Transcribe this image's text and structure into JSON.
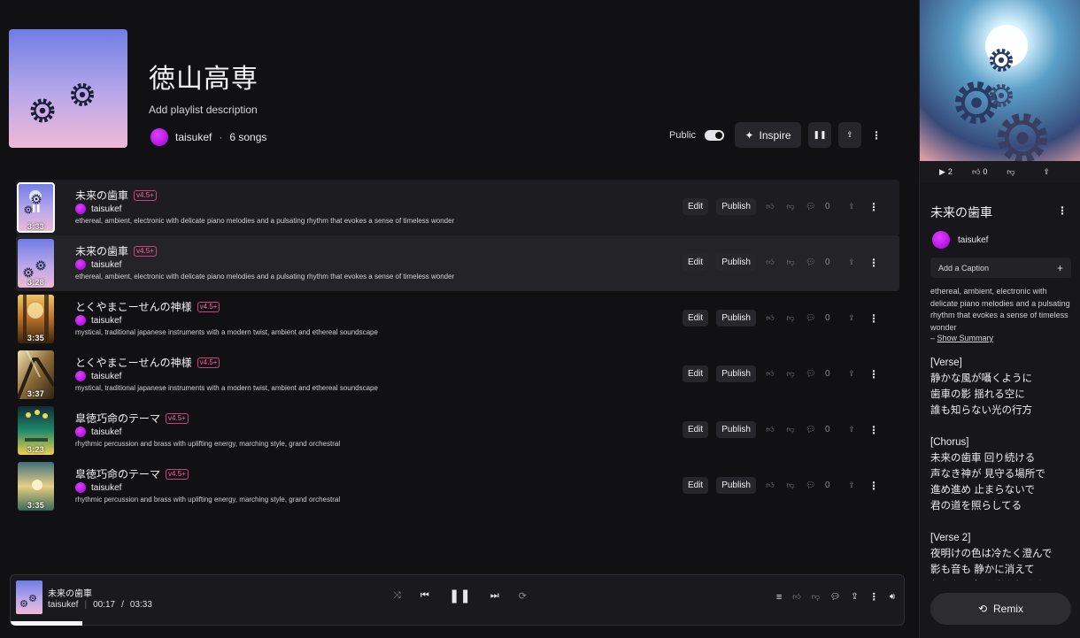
{
  "playlist": {
    "title": "徳山高専",
    "description_placeholder": "Add playlist description",
    "owner": "taisukef",
    "separator": "·",
    "song_count": "6 songs",
    "public_label": "Public",
    "public_on": true,
    "inspire_label": "Inspire"
  },
  "songs": [
    {
      "title": "未来の歯車",
      "version": "v4.5+",
      "artist": "taisukef",
      "description": "ethereal, ambient, electronic with delicate piano melodies and a pulsating rhythm that evokes a sense of timeless wonder",
      "duration": "3:33",
      "edit": "Edit",
      "publish": "Publish",
      "comments": "0"
    },
    {
      "title": "未来の歯車",
      "version": "v4.5+",
      "artist": "taisukef",
      "description": "ethereal, ambient, electronic with delicate piano melodies and a pulsating rhythm that evokes a sense of timeless wonder",
      "duration": "3:28",
      "edit": "Edit",
      "publish": "Publish",
      "comments": "0"
    },
    {
      "title": "とくやまこーせんの神様",
      "version": "v4.5+",
      "artist": "taisukef",
      "description": "mystical, traditional japanese instruments with a modern twist, ambient and ethereal soundscape",
      "duration": "3:35",
      "edit": "Edit",
      "publish": "Publish",
      "comments": "0"
    },
    {
      "title": "とくやまこーせんの神様",
      "version": "v4.5+",
      "artist": "taisukef",
      "description": "mystical, traditional japanese instruments with a modern twist, ambient and ethereal soundscape",
      "duration": "3:37",
      "edit": "Edit",
      "publish": "Publish",
      "comments": "0"
    },
    {
      "title": "皐徳巧命のテーマ",
      "version": "v4.5+",
      "artist": "taisukef",
      "description": "rhythmic percussion and brass with uplifting energy, marching style, grand orchestral",
      "duration": "3:23",
      "edit": "Edit",
      "publish": "Publish",
      "comments": "0"
    },
    {
      "title": "皐徳巧命のテーマ",
      "version": "v4.5+",
      "artist": "taisukef",
      "description": "rhythmic percussion and brass with uplifting energy, marching style, grand orchestral",
      "duration": "3:35",
      "edit": "Edit",
      "publish": "Publish",
      "comments": "0"
    }
  ],
  "player": {
    "title": "未来の歯車",
    "artist": "taisukef",
    "current_time": "00:17",
    "time_sep": "/",
    "total_time": "03:33",
    "progress_fraction": 0.08
  },
  "side": {
    "plays": "2",
    "likes": "0",
    "title": "未来の歯車",
    "artist": "taisukef",
    "caption_placeholder": "Add a Caption",
    "description": "ethereal, ambient, electronic with delicate piano melodies and a pulsating rhythm that evokes a sense of timeless wonder",
    "summary_prefix": "–",
    "summary_label": "Show Summary",
    "lyrics": "[Verse]\n静かな風が囁くように\n歯車の影 揺れる空に\n誰も知らない光の行方\n\n[Chorus]\n未来の歯車 回り続ける\n声なき神が 見守る場所で\n進め進め 止まらないで\n君の道を照らしてる\n\n[Verse 2]\n夜明けの色は冷たく澄んで\n影も音も 静かに消えて\n何もない空に 光を灯すように",
    "remix_label": "Remix"
  },
  "colors": {
    "accent_pink": "#ff5fa0",
    "avatar_purple": "#c020f0",
    "background": "#111114"
  }
}
